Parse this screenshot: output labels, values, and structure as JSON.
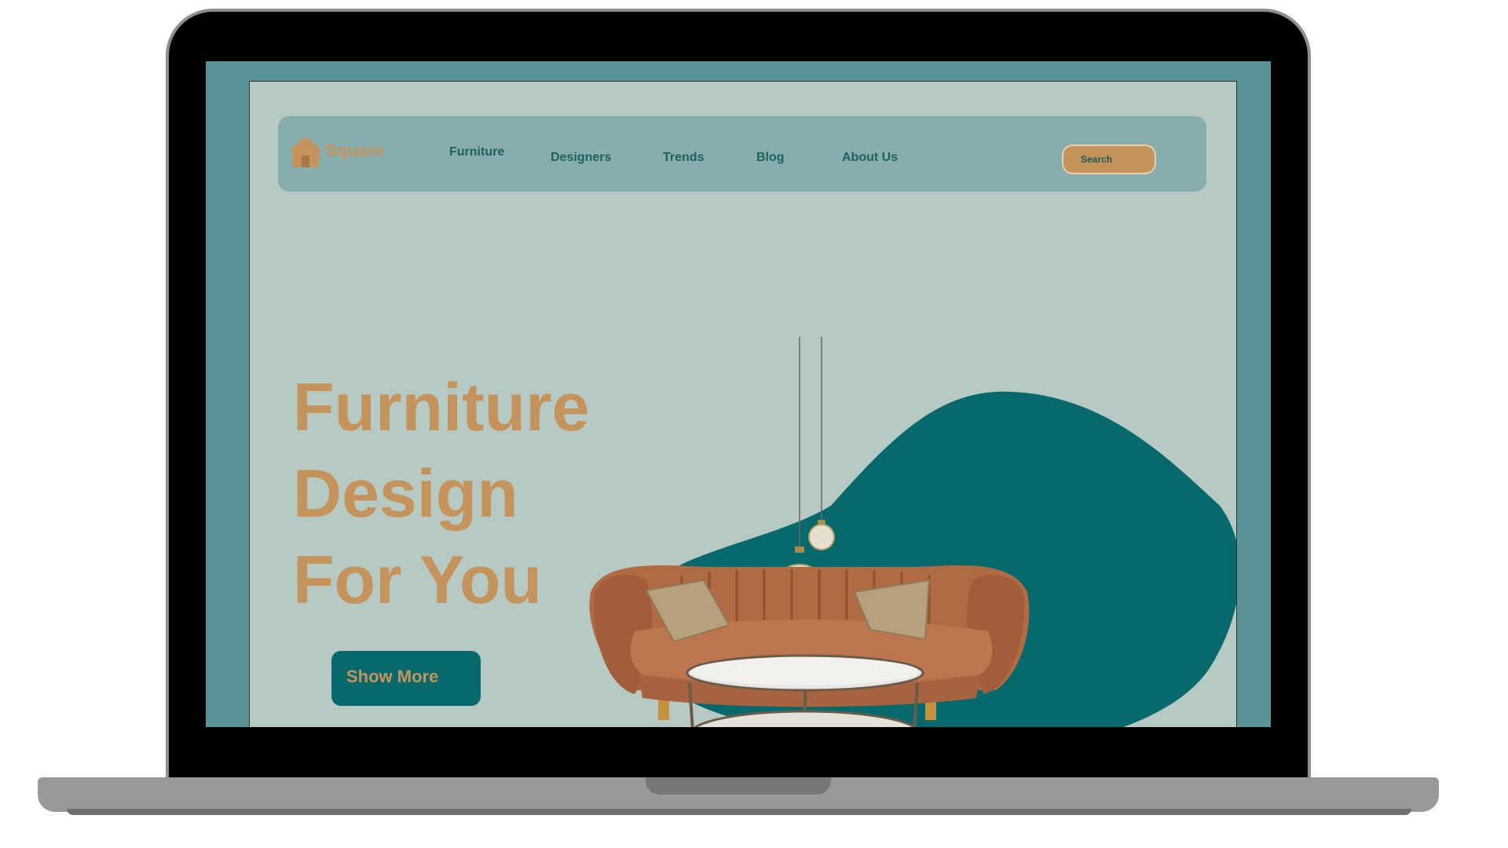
{
  "brand": {
    "name": "Square"
  },
  "nav": {
    "items": [
      "Furniture",
      "Designers",
      "Trends",
      "Blog",
      "About Us"
    ],
    "search_label": "Search"
  },
  "hero": {
    "title_lines": [
      "Furniture",
      "Design",
      "For You"
    ],
    "cta_label": "Show More"
  },
  "colors": {
    "screen_bg": "#5a9396",
    "page_bg": "#b6c9c3",
    "navbar_bg": "#87aead",
    "accent_gold": "#c4945c",
    "teal_dark": "#07696c",
    "nav_text": "#1c6263"
  },
  "icons": {
    "logo": "house-icon"
  },
  "illustration": {
    "subject": "sofa-with-coffee-table-and-pendant-lamps"
  }
}
